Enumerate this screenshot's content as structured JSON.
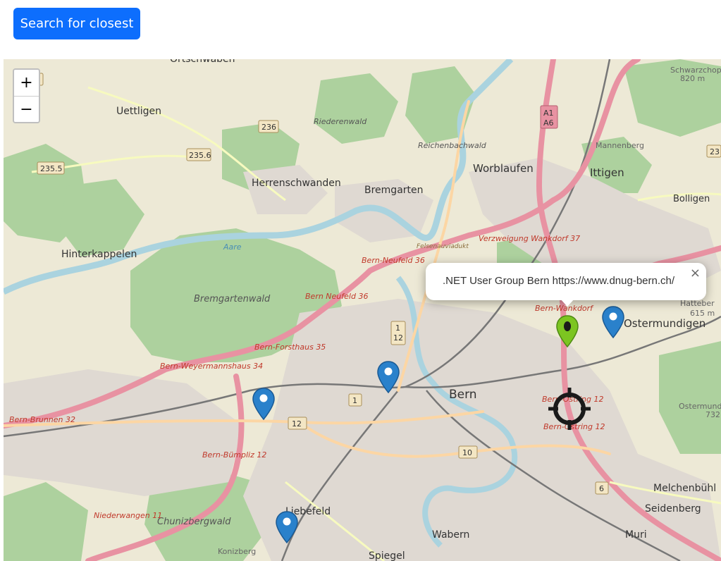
{
  "toolbar": {
    "search_label": "Search for closest"
  },
  "zoom": {
    "in_label": "+",
    "out_label": "−"
  },
  "popup": {
    "text": ".NET User Group Bern https://www.dnug-bern.ch/",
    "close": "×"
  },
  "map": {
    "places": [
      "Ortschwaben",
      "Uettligen",
      "Herrenschwanden",
      "Bremgarten",
      "Worblaufen",
      "Ittigen",
      "Bolligen",
      "Mannenberg",
      "Schwarzchop",
      "Hinterkappelen",
      "Bremgartenwald",
      "Ostermundigen",
      "Bern",
      "Liebefeld",
      "Wabern",
      "Spiegel",
      "Muri",
      "Seidenberg",
      "Melchenbühl",
      "Chunizbergwald",
      "Konizberg",
      "Riederenwald",
      "Reichenbachwald",
      "Aare",
      "Hatteber",
      "Ostermund",
      "Niederwangen",
      "Niederwangen"
    ],
    "roads": [
      "Bern-Neufeld 36",
      "Bern Neufeld 36",
      "Bern-Forsthaus 35",
      "Bern-Weyermannshaus 34",
      "Bern-Brunnen 32",
      "Bern-Bümpliz 12",
      "Verzweigung Wankdorf 37",
      "Bern-Wankdorf",
      "Bern-Ostring 12",
      "Bern-Ostring 12",
      "Felsenauviadukt",
      "Niederwangen 11"
    ],
    "shields": [
      "236",
      "235.6",
      "235.5",
      "A1",
      "A6",
      "1",
      "12",
      "12",
      "1",
      "10",
      "6",
      "23",
      "4"
    ],
    "elevations": [
      "820 m",
      "615 m",
      "732"
    ]
  },
  "markers": {
    "green": {
      "color": "#7cc521"
    },
    "blue": {
      "color": "#2a81cb"
    }
  }
}
